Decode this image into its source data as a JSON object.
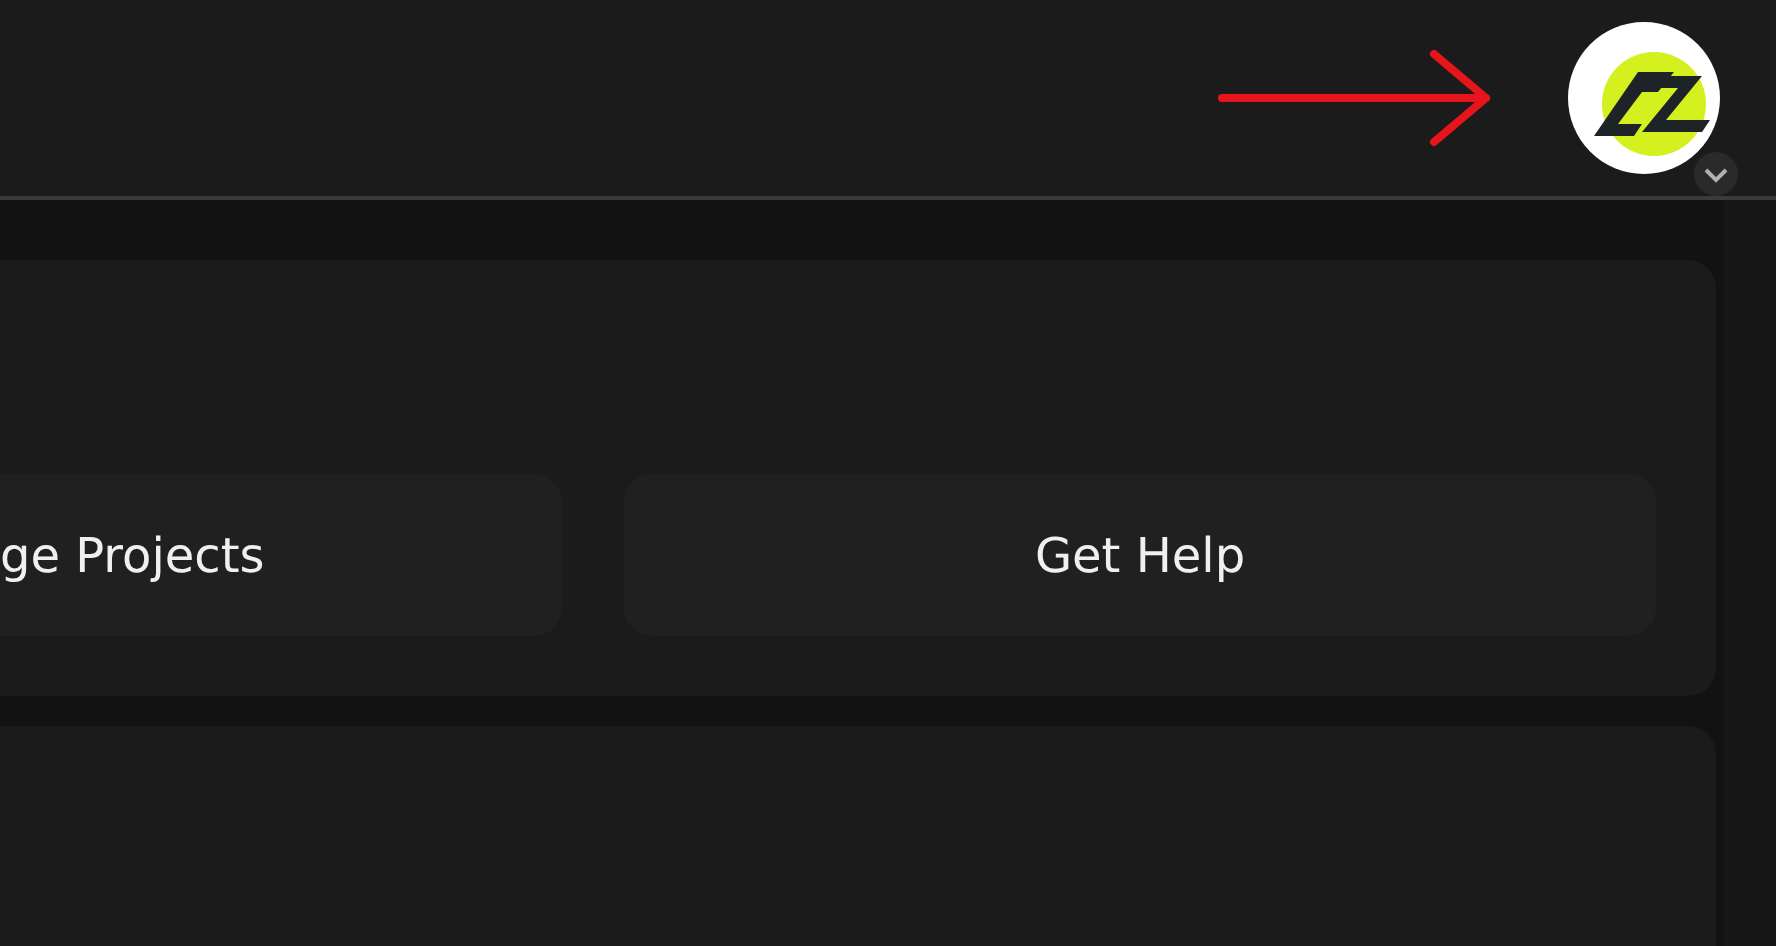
{
  "actions": [
    {
      "label": "ge Projects"
    },
    {
      "label": "Get Help"
    }
  ]
}
